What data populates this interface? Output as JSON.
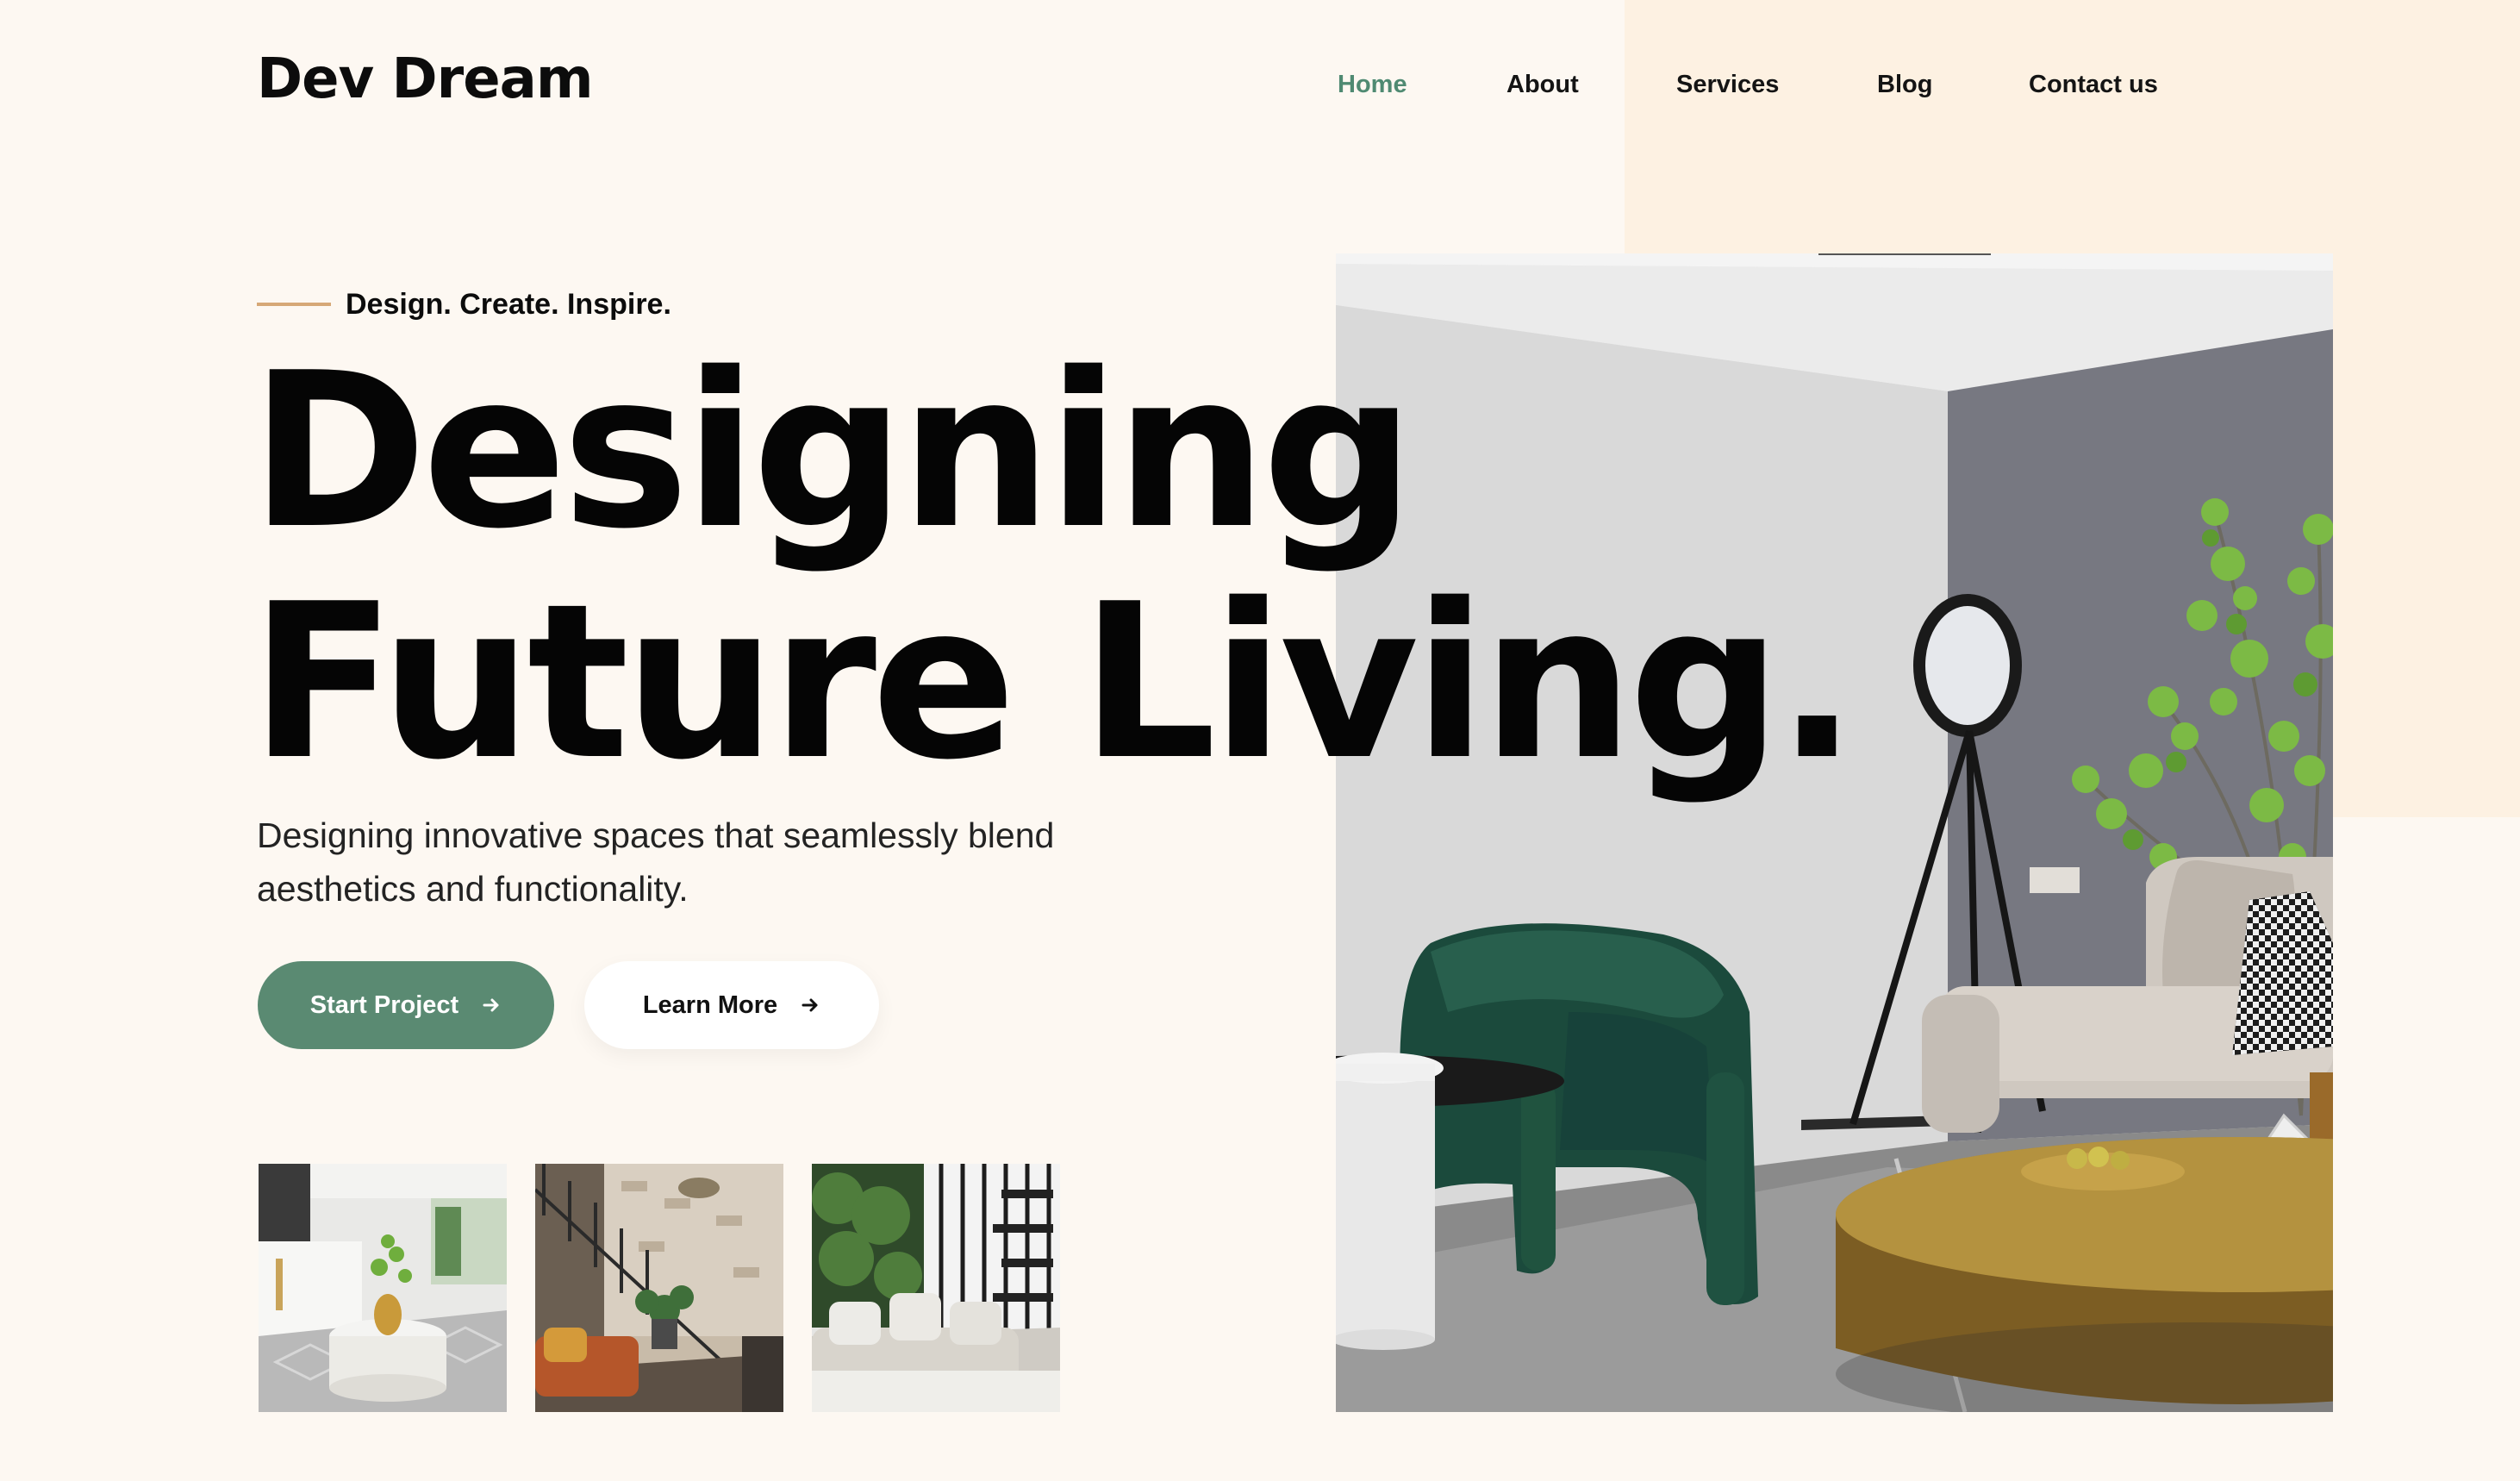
{
  "brand": {
    "logo": "Dev Dream"
  },
  "nav": {
    "items": [
      {
        "label": "Home",
        "active": true
      },
      {
        "label": "About",
        "active": false
      },
      {
        "label": "Services",
        "active": false
      },
      {
        "label": "Blog",
        "active": false
      },
      {
        "label": "Contact us",
        "active": false
      }
    ]
  },
  "hero": {
    "tagline": "Design. Create. Inspire.",
    "headline_line1": "Designing",
    "headline_line2": "Future Living.",
    "subtext": "Designing innovative spaces that seamlessly blend aesthetics and functionality.",
    "primary_button": "Start Project",
    "secondary_button": "Learn More"
  },
  "images": {
    "hero": "living-room-green-armchair-photo",
    "thumbnails": [
      "marble-interior-round-table-photo",
      "staircase-loft-orange-sofa-photo",
      "white-sofa-spiral-stair-photo"
    ]
  },
  "colors": {
    "background": "#fdf8f2",
    "peach_block": "#fdf1e2",
    "accent_green": "#5a8a72",
    "nav_active": "#4f8a72",
    "tag_line": "#d6a877",
    "text": "#0c0c0c"
  },
  "icons": {
    "button_arrow": "arrow-right-icon"
  }
}
